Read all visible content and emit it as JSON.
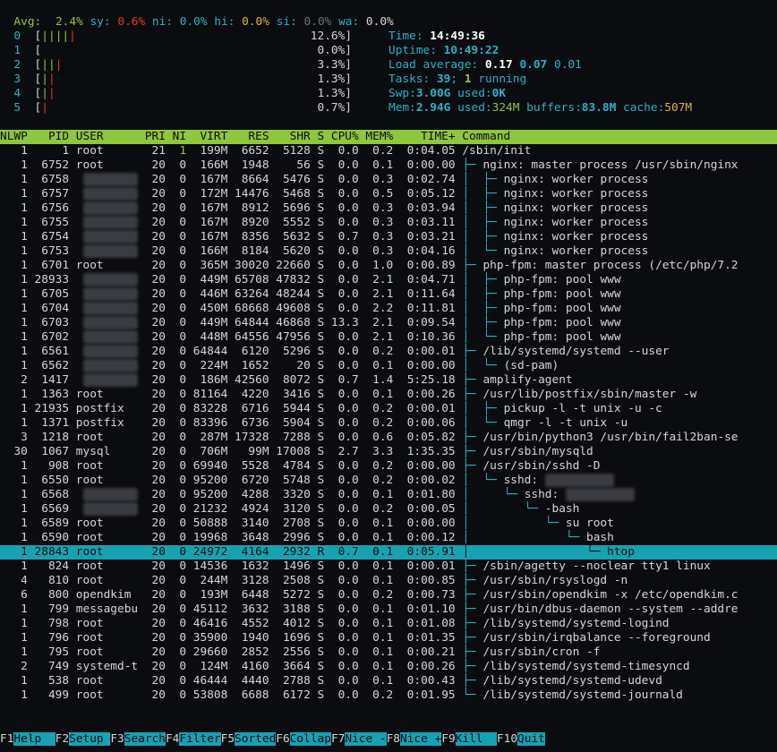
{
  "cpu_summary": {
    "avg_label": "Avg:",
    "avg": "2.4%",
    "sy_label": "sy:",
    "sy": "0.6%",
    "ni_label": "ni:",
    "ni": "0.0%",
    "hi_label": "hi:",
    "hi": "0.0%",
    "si_label": "si:",
    "si": "0.0%",
    "wa_label": "wa:",
    "wa": "0.0%"
  },
  "cpus": [
    {
      "id": "0",
      "bars": "|||||",
      "color": "mixed",
      "pct": "12.6%]"
    },
    {
      "id": "1",
      "bars": "",
      "color": "g",
      "pct": "0.0%]"
    },
    {
      "id": "2",
      "bars": "|||",
      "color": "mixed",
      "pct": "3.3%]"
    },
    {
      "id": "3",
      "bars": "||",
      "color": "mixed",
      "pct": "1.3%]"
    },
    {
      "id": "4",
      "bars": "||",
      "color": "mixed",
      "pct": "1.3%]"
    },
    {
      "id": "5",
      "bars": "|",
      "color": "r",
      "pct": "0.7%]"
    }
  ],
  "sysinfo": {
    "time_label": "Time:",
    "time": "14:49:36",
    "uptime_label": "Uptime:",
    "uptime": "10:49:22",
    "load_label": "Load average:",
    "load1": "0.17",
    "load5": "0.07",
    "load15": "0.01",
    "tasks_label": "Tasks:",
    "tasks": "39",
    "tasks_sep": ";",
    "running": "1",
    "running_label": "running",
    "swp_label": "Swp:",
    "swp": "3.00G",
    "swp_used_label": "used:",
    "swp_used": "0K",
    "mem_label": "Mem:",
    "mem": "2.94G",
    "mem_used_label": "used:",
    "mem_used": "324M",
    "buffers_label": "buffers:",
    "buffers": "83.8M",
    "cache_label": "cache:",
    "cache": "507M"
  },
  "columns": [
    "NLWP",
    "PID",
    "USER",
    "PRI",
    "NI",
    "VIRT",
    "RES",
    "SHR",
    "S",
    "CPU%",
    "MEM%",
    "TIME+",
    "Command"
  ],
  "processes": [
    {
      "nlwp": "1",
      "pid": "1",
      "user": "root",
      "pri": "21",
      "ni": "1",
      "virt": "199M",
      "res": "6652",
      "shr": "5128",
      "s": "S",
      "cpu": "0.0",
      "mem": "0.2",
      "time": "0:04.05",
      "tree": "",
      "cmd": "/sbin/init"
    },
    {
      "nlwp": "1",
      "pid": "6752",
      "user": "root",
      "pri": "20",
      "ni": "0",
      "virt": "166M",
      "res": "1948",
      "shr": "56",
      "s": "S",
      "cpu": "0.0",
      "mem": "0.1",
      "time": "0:00.00",
      "tree": "├─ ",
      "cmd": "nginx: master process /usr/sbin/nginx"
    },
    {
      "nlwp": "1",
      "pid": "6758",
      "user": "",
      "pri": "20",
      "ni": "0",
      "virt": "167M",
      "res": "8664",
      "shr": "5476",
      "s": "S",
      "cpu": "0.0",
      "mem": "0.3",
      "time": "0:02.74",
      "tree": "│  ├─ ",
      "cmd": "nginx: worker process"
    },
    {
      "nlwp": "1",
      "pid": "6757",
      "user": "",
      "pri": "20",
      "ni": "0",
      "virt": "172M",
      "res": "14476",
      "shr": "5468",
      "s": "S",
      "cpu": "0.0",
      "mem": "0.5",
      "time": "0:05.12",
      "tree": "│  ├─ ",
      "cmd": "nginx: worker process"
    },
    {
      "nlwp": "1",
      "pid": "6756",
      "user": "",
      "pri": "20",
      "ni": "0",
      "virt": "167M",
      "res": "8912",
      "shr": "5696",
      "s": "S",
      "cpu": "0.0",
      "mem": "0.3",
      "time": "0:03.94",
      "tree": "│  ├─ ",
      "cmd": "nginx: worker process"
    },
    {
      "nlwp": "1",
      "pid": "6755",
      "user": "",
      "pri": "20",
      "ni": "0",
      "virt": "167M",
      "res": "8920",
      "shr": "5552",
      "s": "S",
      "cpu": "0.0",
      "mem": "0.3",
      "time": "0:03.11",
      "tree": "│  ├─ ",
      "cmd": "nginx: worker process"
    },
    {
      "nlwp": "1",
      "pid": "6754",
      "user": "",
      "pri": "20",
      "ni": "0",
      "virt": "167M",
      "res": "8356",
      "shr": "5632",
      "s": "S",
      "cpu": "0.7",
      "mem": "0.3",
      "time": "0:03.21",
      "tree": "│  ├─ ",
      "cmd": "nginx: worker process"
    },
    {
      "nlwp": "1",
      "pid": "6753",
      "user": "",
      "pri": "20",
      "ni": "0",
      "virt": "166M",
      "res": "8184",
      "shr": "5620",
      "s": "S",
      "cpu": "0.0",
      "mem": "0.3",
      "time": "0:04.16",
      "tree": "│  └─ ",
      "cmd": "nginx: worker process"
    },
    {
      "nlwp": "1",
      "pid": "6701",
      "user": "root",
      "pri": "20",
      "ni": "0",
      "virt": "365M",
      "res": "30020",
      "shr": "22660",
      "s": "S",
      "cpu": "0.0",
      "mem": "1.0",
      "time": "0:00.89",
      "tree": "├─ ",
      "cmd": "php-fpm: master process (/etc/php/7.2"
    },
    {
      "nlwp": "1",
      "pid": "28933",
      "user": "",
      "pri": "20",
      "ni": "0",
      "virt": "449M",
      "res": "65708",
      "shr": "47832",
      "s": "S",
      "cpu": "0.0",
      "mem": "2.1",
      "time": "0:04.71",
      "tree": "│  ├─ ",
      "cmd": "php-fpm: pool www"
    },
    {
      "nlwp": "1",
      "pid": "6705",
      "user": "",
      "pri": "20",
      "ni": "0",
      "virt": "446M",
      "res": "63264",
      "shr": "48244",
      "s": "S",
      "cpu": "0.0",
      "mem": "2.1",
      "time": "0:11.64",
      "tree": "│  ├─ ",
      "cmd": "php-fpm: pool www"
    },
    {
      "nlwp": "1",
      "pid": "6704",
      "user": "",
      "pri": "20",
      "ni": "0",
      "virt": "450M",
      "res": "68668",
      "shr": "49608",
      "s": "S",
      "cpu": "0.0",
      "mem": "2.2",
      "time": "0:11.81",
      "tree": "│  ├─ ",
      "cmd": "php-fpm: pool www"
    },
    {
      "nlwp": "1",
      "pid": "6703",
      "user": "",
      "pri": "20",
      "ni": "0",
      "virt": "449M",
      "res": "64844",
      "shr": "46868",
      "s": "S",
      "cpu": "13.3",
      "mem": "2.1",
      "time": "0:09.54",
      "tree": "│  ├─ ",
      "cmd": "php-fpm: pool www"
    },
    {
      "nlwp": "1",
      "pid": "6702",
      "user": "",
      "pri": "20",
      "ni": "0",
      "virt": "448M",
      "res": "64556",
      "shr": "47956",
      "s": "S",
      "cpu": "0.0",
      "mem": "2.1",
      "time": "0:10.36",
      "tree": "│  └─ ",
      "cmd": "php-fpm: pool www"
    },
    {
      "nlwp": "1",
      "pid": "6561",
      "user": "",
      "pri": "20",
      "ni": "0",
      "virt": "64844",
      "res": "6120",
      "shr": "5296",
      "s": "S",
      "cpu": "0.0",
      "mem": "0.2",
      "time": "0:00.01",
      "tree": "├─ ",
      "cmd": "/lib/systemd/systemd --user"
    },
    {
      "nlwp": "1",
      "pid": "6562",
      "user": "",
      "pri": "20",
      "ni": "0",
      "virt": "224M",
      "res": "1652",
      "shr": "20",
      "s": "S",
      "cpu": "0.0",
      "mem": "0.1",
      "time": "0:00.00",
      "tree": "│  └─ ",
      "cmd": "(sd-pam)"
    },
    {
      "nlwp": "2",
      "pid": "1417",
      "user": "",
      "pri": "20",
      "ni": "0",
      "virt": "186M",
      "res": "42560",
      "shr": "8072",
      "s": "S",
      "cpu": "0.7",
      "mem": "1.4",
      "time": "5:25.18",
      "tree": "├─ ",
      "cmd": "amplify-agent"
    },
    {
      "nlwp": "1",
      "pid": "1363",
      "user": "root",
      "pri": "20",
      "ni": "0",
      "virt": "81164",
      "res": "4220",
      "shr": "3416",
      "s": "S",
      "cpu": "0.0",
      "mem": "0.1",
      "time": "0:00.26",
      "tree": "├─ ",
      "cmd": "/usr/lib/postfix/sbin/master -w"
    },
    {
      "nlwp": "1",
      "pid": "21935",
      "user": "postfix",
      "pri": "20",
      "ni": "0",
      "virt": "83228",
      "res": "6716",
      "shr": "5944",
      "s": "S",
      "cpu": "0.0",
      "mem": "0.2",
      "time": "0:00.01",
      "tree": "│  ├─ ",
      "cmd": "pickup -l -t unix -u -c"
    },
    {
      "nlwp": "1",
      "pid": "1371",
      "user": "postfix",
      "pri": "20",
      "ni": "0",
      "virt": "83396",
      "res": "6736",
      "shr": "5904",
      "s": "S",
      "cpu": "0.0",
      "mem": "0.2",
      "time": "0:00.06",
      "tree": "│  └─ ",
      "cmd": "qmgr -l -t unix -u"
    },
    {
      "nlwp": "3",
      "pid": "1218",
      "user": "root",
      "pri": "20",
      "ni": "0",
      "virt": "287M",
      "res": "17328",
      "shr": "7288",
      "s": "S",
      "cpu": "0.0",
      "mem": "0.6",
      "time": "0:05.82",
      "tree": "├─ ",
      "cmd": "/usr/bin/python3 /usr/bin/fail2ban-se"
    },
    {
      "nlwp": "30",
      "pid": "1067",
      "user": "mysql",
      "pri": "20",
      "ni": "0",
      "virt": "706M",
      "res": "99M",
      "shr": "17008",
      "s": "S",
      "cpu": "2.7",
      "mem": "3.3",
      "time": "1:35.35",
      "tree": "├─ ",
      "cmd": "/usr/sbin/mysqld"
    },
    {
      "nlwp": "1",
      "pid": "908",
      "user": "root",
      "pri": "20",
      "ni": "0",
      "virt": "69940",
      "res": "5528",
      "shr": "4784",
      "s": "S",
      "cpu": "0.0",
      "mem": "0.2",
      "time": "0:00.00",
      "tree": "├─ ",
      "cmd": "/usr/sbin/sshd -D"
    },
    {
      "nlwp": "1",
      "pid": "6550",
      "user": "root",
      "pri": "20",
      "ni": "0",
      "virt": "95200",
      "res": "6720",
      "shr": "5748",
      "s": "S",
      "cpu": "0.0",
      "mem": "0.2",
      "time": "0:00.02",
      "tree": "│  └─ ",
      "cmd": "sshd: "
    },
    {
      "nlwp": "1",
      "pid": "6568",
      "user": "",
      "pri": "20",
      "ni": "0",
      "virt": "95200",
      "res": "4288",
      "shr": "3320",
      "s": "S",
      "cpu": "0.0",
      "mem": "0.1",
      "time": "0:01.80",
      "tree": "│     └─ ",
      "cmd": "sshd: "
    },
    {
      "nlwp": "1",
      "pid": "6569",
      "user": "",
      "pri": "20",
      "ni": "0",
      "virt": "21232",
      "res": "4924",
      "shr": "3120",
      "s": "S",
      "cpu": "0.0",
      "mem": "0.2",
      "time": "0:00.05",
      "tree": "│        └─ ",
      "cmd": "-bash"
    },
    {
      "nlwp": "1",
      "pid": "6589",
      "user": "root",
      "pri": "20",
      "ni": "0",
      "virt": "50888",
      "res": "3140",
      "shr": "2708",
      "s": "S",
      "cpu": "0.0",
      "mem": "0.1",
      "time": "0:00.00",
      "tree": "│           └─ ",
      "cmd": "su root"
    },
    {
      "nlwp": "1",
      "pid": "6590",
      "user": "root",
      "pri": "20",
      "ni": "0",
      "virt": "19968",
      "res": "3648",
      "shr": "2996",
      "s": "S",
      "cpu": "0.0",
      "mem": "0.1",
      "time": "0:00.12",
      "tree": "│              └─ ",
      "cmd": "bash"
    },
    {
      "nlwp": "1",
      "pid": "28843",
      "user": "root",
      "pri": "20",
      "ni": "0",
      "virt": "24972",
      "res": "4164",
      "shr": "2932",
      "s": "R",
      "cpu": "0.7",
      "mem": "0.1",
      "time": "0:05.91",
      "tree": "│                 └─ ",
      "cmd": "htop",
      "selected": true
    },
    {
      "nlwp": "1",
      "pid": "824",
      "user": "root",
      "pri": "20",
      "ni": "0",
      "virt": "14536",
      "res": "1632",
      "shr": "1496",
      "s": "S",
      "cpu": "0.0",
      "mem": "0.1",
      "time": "0:00.01",
      "tree": "├─ ",
      "cmd": "/sbin/agetty --noclear tty1 linux"
    },
    {
      "nlwp": "4",
      "pid": "810",
      "user": "root",
      "pri": "20",
      "ni": "0",
      "virt": "244M",
      "res": "3128",
      "shr": "2508",
      "s": "S",
      "cpu": "0.0",
      "mem": "0.1",
      "time": "0:00.85",
      "tree": "├─ ",
      "cmd": "/usr/sbin/rsyslogd -n"
    },
    {
      "nlwp": "6",
      "pid": "800",
      "user": "opendkim",
      "pri": "20",
      "ni": "0",
      "virt": "193M",
      "res": "6448",
      "shr": "5272",
      "s": "S",
      "cpu": "0.0",
      "mem": "0.2",
      "time": "0:00.73",
      "tree": "├─ ",
      "cmd": "/usr/sbin/opendkim -x /etc/opendkim.c"
    },
    {
      "nlwp": "1",
      "pid": "799",
      "user": "messagebu",
      "pri": "20",
      "ni": "0",
      "virt": "45112",
      "res": "3632",
      "shr": "3188",
      "s": "S",
      "cpu": "0.0",
      "mem": "0.1",
      "time": "0:01.10",
      "tree": "├─ ",
      "cmd": "/usr/bin/dbus-daemon --system --addre"
    },
    {
      "nlwp": "1",
      "pid": "798",
      "user": "root",
      "pri": "20",
      "ni": "0",
      "virt": "46416",
      "res": "4552",
      "shr": "4012",
      "s": "S",
      "cpu": "0.0",
      "mem": "0.1",
      "time": "0:01.08",
      "tree": "├─ ",
      "cmd": "/lib/systemd/systemd-logind"
    },
    {
      "nlwp": "1",
      "pid": "796",
      "user": "root",
      "pri": "20",
      "ni": "0",
      "virt": "35900",
      "res": "1940",
      "shr": "1696",
      "s": "S",
      "cpu": "0.0",
      "mem": "0.1",
      "time": "0:01.35",
      "tree": "├─ ",
      "cmd": "/usr/sbin/irqbalance --foreground"
    },
    {
      "nlwp": "1",
      "pid": "795",
      "user": "root",
      "pri": "20",
      "ni": "0",
      "virt": "29660",
      "res": "2852",
      "shr": "2556",
      "s": "S",
      "cpu": "0.0",
      "mem": "0.1",
      "time": "0:00.21",
      "tree": "├─ ",
      "cmd": "/usr/sbin/cron -f"
    },
    {
      "nlwp": "2",
      "pid": "749",
      "user": "systemd-t",
      "pri": "20",
      "ni": "0",
      "virt": "124M",
      "res": "4160",
      "shr": "3664",
      "s": "S",
      "cpu": "0.0",
      "mem": "0.1",
      "time": "0:00.26",
      "tree": "├─ ",
      "cmd": "/lib/systemd/systemd-timesyncd"
    },
    {
      "nlwp": "1",
      "pid": "538",
      "user": "root",
      "pri": "20",
      "ni": "0",
      "virt": "46444",
      "res": "4440",
      "shr": "2788",
      "s": "S",
      "cpu": "0.0",
      "mem": "0.1",
      "time": "0:00.43",
      "tree": "├─ ",
      "cmd": "/lib/systemd/systemd-udevd"
    },
    {
      "nlwp": "1",
      "pid": "499",
      "user": "root",
      "pri": "20",
      "ni": "0",
      "virt": "53808",
      "res": "6688",
      "shr": "6172",
      "s": "S",
      "cpu": "0.0",
      "mem": "0.2",
      "time": "0:01.95",
      "tree": "└─ ",
      "cmd": "/lib/systemd/systemd-journald"
    }
  ],
  "fkeys": [
    {
      "key": "F1",
      "label": "Help  "
    },
    {
      "key": "F2",
      "label": "Setup "
    },
    {
      "key": "F3",
      "label": "Search"
    },
    {
      "key": "F4",
      "label": "Filter"
    },
    {
      "key": "F5",
      "label": "Sorted"
    },
    {
      "key": "F6",
      "label": "Collap"
    },
    {
      "key": "F7",
      "label": "Nice -"
    },
    {
      "key": "F8",
      "label": "Nice +"
    },
    {
      "key": "F9",
      "label": "Kill  "
    },
    {
      "key": "F10",
      "label": "Quit"
    }
  ],
  "colors": {
    "header_bg": "#8ec63f",
    "selected_bg": "#17a2b3",
    "bg": "#0b0c0f"
  }
}
